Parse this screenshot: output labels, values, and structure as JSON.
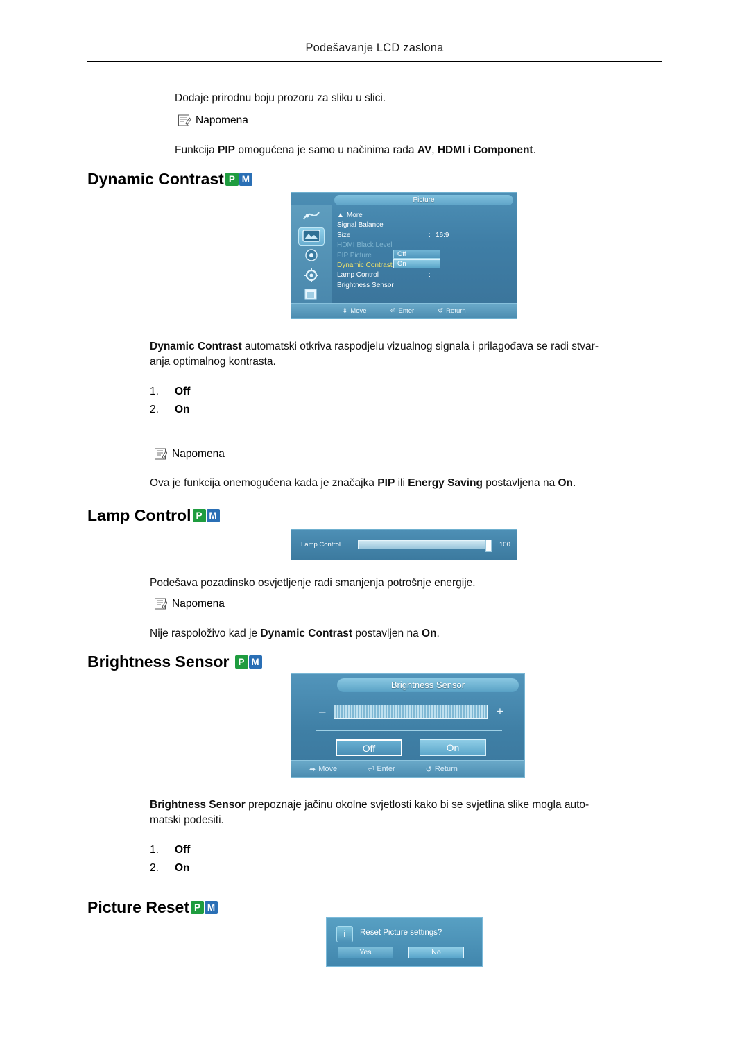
{
  "header": {
    "title": "Podešavanje LCD zaslona"
  },
  "intro": {
    "line1": "Dodaje prirodnu boju prozoru za sliku u slici.",
    "note_label": "Napomena",
    "note_text_pre": "Funkcija ",
    "note_bold1": "PIP",
    "note_text_mid": " omogućena je samo u načinima rada ",
    "note_bold2": "AV",
    "note_text_mid2": ", ",
    "note_bold3": "HDMI",
    "note_text_mid3": " i ",
    "note_bold4": "Component",
    "note_text_end": "."
  },
  "sections": {
    "dynamic_contrast": {
      "title": "Dynamic Contrast",
      "badges": [
        "P",
        "M"
      ],
      "desc_bold": "Dynamic Contrast",
      "desc_rest": " automatski otkriva raspodjelu vizualnog signala i prilagođava se radi stvar-",
      "desc_line2": "anja optimalnog kontrasta.",
      "options": [
        {
          "num": "1.",
          "value": "Off"
        },
        {
          "num": "2.",
          "value": "On"
        }
      ],
      "note_label": "Napomena",
      "note_pre": "Ova je funkcija onemogućena kada je značajka ",
      "note_b1": "PIP",
      "note_mid": " ili ",
      "note_b2": "Energy Saving",
      "note_mid2": " postavljena na ",
      "note_b3": "On",
      "note_end": "."
    },
    "lamp_control": {
      "title": "Lamp Control",
      "badges": [
        "P",
        "M"
      ],
      "desc": "Podešava pozadinsko osvjetljenje radi smanjenja potrošnje energije.",
      "note_label": "Napomena",
      "note_pre": "Nije raspoloživo kad je ",
      "note_b1": "Dynamic Contrast",
      "note_mid": " postavljen na ",
      "note_b2": "On",
      "note_end": "."
    },
    "brightness_sensor": {
      "title": "Brightness Sensor",
      "badges": [
        "P",
        "M"
      ],
      "desc_bold": "Brightness Sensor",
      "desc_rest": " prepoznaje jačinu okolne svjetlosti kako bi se svjetlina slike mogla auto-",
      "desc_line2": "matski podesiti.",
      "options": [
        {
          "num": "1.",
          "value": "Off"
        },
        {
          "num": "2.",
          "value": "On"
        }
      ]
    },
    "picture_reset": {
      "title": "Picture Reset",
      "badges": [
        "P",
        "M"
      ]
    }
  },
  "osd_picture": {
    "title": "Picture",
    "items": [
      {
        "label": "More",
        "value": "",
        "state": "normal",
        "arrow": true
      },
      {
        "label": "Signal Balance",
        "value": "",
        "state": "normal"
      },
      {
        "label": "Size",
        "value": "16:9",
        "state": "normal",
        "colon": ":"
      },
      {
        "label": "HDMI Black Level",
        "value": "",
        "state": "dim"
      },
      {
        "label": "PIP Picture",
        "value": "",
        "state": "dim"
      },
      {
        "label": "Dynamic Contrast",
        "value": "",
        "state": "highlight"
      },
      {
        "label": "Lamp Control",
        "value": "",
        "state": "normal"
      },
      {
        "label": "Brightness Sensor",
        "value": "",
        "state": "normal"
      }
    ],
    "dropdown": {
      "off": "Off",
      "on": "On"
    },
    "footer": [
      {
        "icon": "updown-arrow-icon",
        "label": "Move"
      },
      {
        "icon": "enter-icon",
        "label": "Enter"
      },
      {
        "icon": "return-icon",
        "label": "Return"
      }
    ]
  },
  "osd_lamp": {
    "label": "Lamp Control",
    "value": "100"
  },
  "osd_brightness": {
    "title": "Brightness Sensor",
    "minus": "–",
    "plus": "+",
    "off": "Off",
    "on": "On",
    "footer": [
      {
        "icon": "leftright-arrow-icon",
        "label": "Move"
      },
      {
        "icon": "enter-icon",
        "label": "Enter"
      },
      {
        "icon": "return-icon",
        "label": "Return"
      }
    ]
  },
  "osd_reset": {
    "icon": "info-icon",
    "message": "Reset Picture settings?",
    "yes": "Yes",
    "no": "No"
  }
}
